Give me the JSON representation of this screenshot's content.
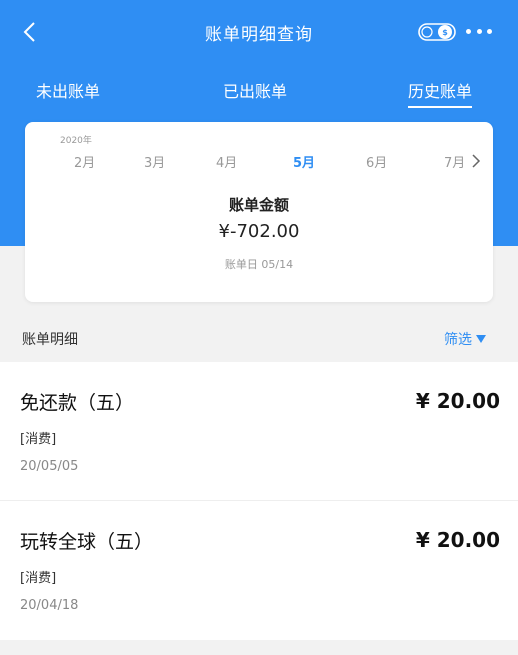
{
  "header": {
    "title": "账单明细查询",
    "back_icon": "chevron-left-icon",
    "toggle_icon": "toggle-switch-icon",
    "more_icon": "more-horizontal-icon"
  },
  "tabs": [
    {
      "label": "未出账单",
      "active": false
    },
    {
      "label": "已出账单",
      "active": false
    },
    {
      "label": "历史账单",
      "active": true
    }
  ],
  "bill_card": {
    "year": "2020年",
    "months": [
      "2月",
      "3月",
      "4月",
      "5月",
      "6月",
      "7月"
    ],
    "selected_month": "5月",
    "amount_label": "账单金额",
    "amount_value": "¥-702.00",
    "bill_date": "账单日 05/14"
  },
  "details": {
    "title": "账单明细",
    "filter_label": "筛选"
  },
  "transactions": [
    {
      "name": "免还款（五）",
      "amount": "¥ 20.00",
      "tag": "[消费]",
      "date": "20/05/05"
    },
    {
      "name": "玩转全球（五）",
      "amount": "¥ 20.00",
      "tag": "[消费]",
      "date": "20/04/18"
    }
  ],
  "colors": {
    "primary": "#2f8ef3",
    "background": "#f2f2f2"
  }
}
